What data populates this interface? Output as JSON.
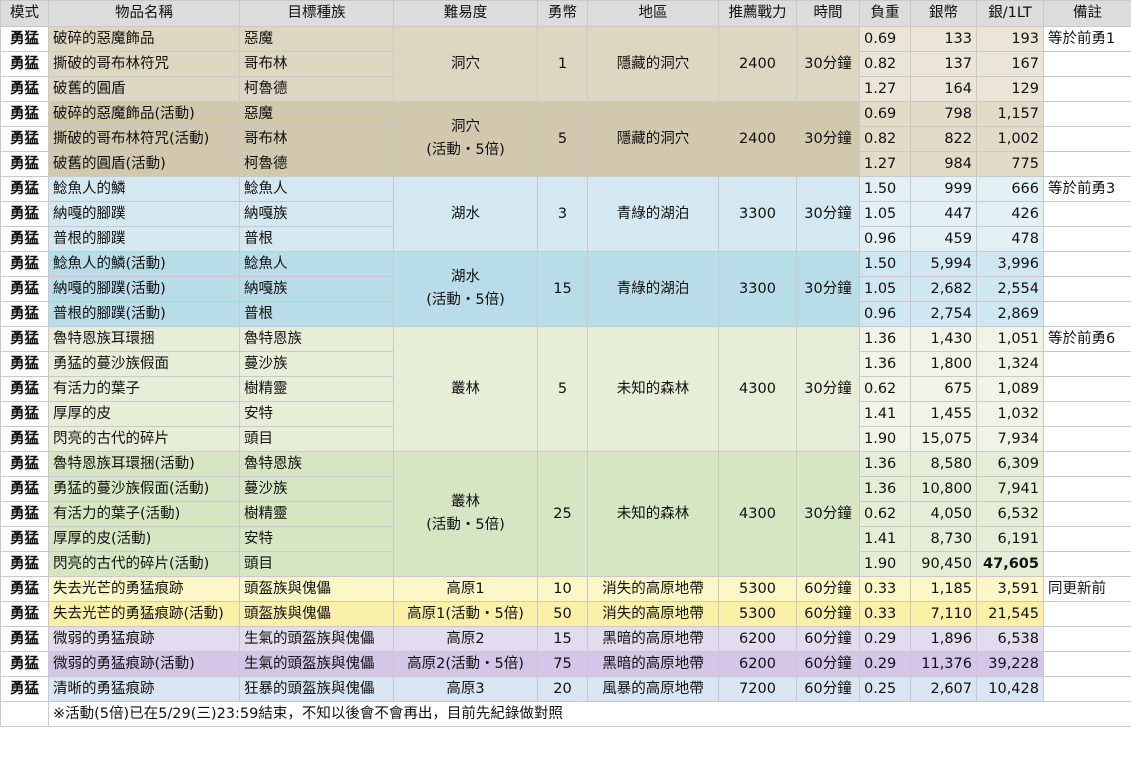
{
  "headers": [
    "模式",
    "物品名稱",
    "目標種族",
    "難易度",
    "勇幣",
    "地區",
    "推薦戰力",
    "時間",
    "負重",
    "銀幣",
    "銀/1LT",
    "備註"
  ],
  "colors": {
    "cave_a": "#ddd6c1",
    "cave_a_light": "#eae5d6",
    "cave_b": "#d1c8ad",
    "cave_b_light": "#e1dbc8",
    "lake_a": "#d3e8f1",
    "lake_a_light": "#e3f1f7",
    "lake_b": "#b8dce8",
    "lake_b_light": "#cfe7f0",
    "forest_a": "#e6eed8",
    "forest_a_light": "#eff4e6",
    "forest_b": "#d6e6c2",
    "forest_b_light": "#e4eed6",
    "plateau1": "#fdf6c6",
    "plateau1_event": "#fbf0a8",
    "plateau2": "#e3dbee",
    "plateau2_event": "#d3c6e6",
    "plateau3": "#d9e5f3"
  },
  "groups": [
    {
      "mode": "勇猛",
      "difficulty": [
        "洞穴"
      ],
      "coins": "1",
      "region": "隱藏的洞穴",
      "power": "2400",
      "time": "30分鐘",
      "bg": "cave_a",
      "bg_num": "cave_a_light",
      "rows": [
        {
          "item": "破碎的惡魔飾品",
          "race": "惡魔",
          "weight": "0.69",
          "silver": "133",
          "per": "193",
          "note": "等於前勇1"
        },
        {
          "item": "撕破的哥布林符咒",
          "race": "哥布林",
          "weight": "0.82",
          "silver": "137",
          "per": "167",
          "note": ""
        },
        {
          "item": "破舊的圓盾",
          "race": "柯魯德",
          "weight": "1.27",
          "silver": "164",
          "per": "129",
          "note": ""
        }
      ]
    },
    {
      "mode": "勇猛",
      "difficulty": [
        "洞穴",
        "(活動・5倍)"
      ],
      "coins": "5",
      "region": "隱藏的洞穴",
      "power": "2400",
      "time": "30分鐘",
      "bg": "cave_b",
      "bg_num": "cave_b_light",
      "rows": [
        {
          "item": "破碎的惡魔飾品(活動)",
          "race": "惡魔",
          "weight": "0.69",
          "silver": "798",
          "per": "1,157",
          "note": ""
        },
        {
          "item": "撕破的哥布林符咒(活動)",
          "race": "哥布林",
          "weight": "0.82",
          "silver": "822",
          "per": "1,002",
          "note": ""
        },
        {
          "item": "破舊的圓盾(活動)",
          "race": "柯魯德",
          "weight": "1.27",
          "silver": "984",
          "per": "775",
          "note": ""
        }
      ]
    },
    {
      "mode": "勇猛",
      "difficulty": [
        "湖水"
      ],
      "coins": "3",
      "region": "青綠的湖泊",
      "power": "3300",
      "time": "30分鐘",
      "bg": "lake_a",
      "bg_num": "lake_a_light",
      "rows": [
        {
          "item": "鯰魚人的鱗",
          "race": "鯰魚人",
          "weight": "1.50",
          "silver": "999",
          "per": "666",
          "note": "等於前勇3"
        },
        {
          "item": "納嘎的腳蹼",
          "race": "納嘎族",
          "weight": "1.05",
          "silver": "447",
          "per": "426",
          "note": ""
        },
        {
          "item": "普根的腳蹼",
          "race": "普根",
          "weight": "0.96",
          "silver": "459",
          "per": "478",
          "note": ""
        }
      ]
    },
    {
      "mode": "勇猛",
      "difficulty": [
        "湖水",
        "(活動・5倍)"
      ],
      "coins": "15",
      "region": "青綠的湖泊",
      "power": "3300",
      "time": "30分鐘",
      "bg": "lake_b",
      "bg_num": "lake_b_light",
      "rows": [
        {
          "item": "鯰魚人的鱗(活動)",
          "race": "鯰魚人",
          "weight": "1.50",
          "silver": "5,994",
          "per": "3,996",
          "note": ""
        },
        {
          "item": "納嘎的腳蹼(活動)",
          "race": "納嘎族",
          "weight": "1.05",
          "silver": "2,682",
          "per": "2,554",
          "note": ""
        },
        {
          "item": "普根的腳蹼(活動)",
          "race": "普根",
          "weight": "0.96",
          "silver": "2,754",
          "per": "2,869",
          "note": ""
        }
      ]
    },
    {
      "mode": "勇猛",
      "difficulty": [
        "叢林"
      ],
      "coins": "5",
      "region": "未知的森林",
      "power": "4300",
      "time": "30分鐘",
      "bg": "forest_a",
      "bg_num": "forest_a_light",
      "rows": [
        {
          "item": "魯特恩族耳環捆",
          "race": "魯特恩族",
          "weight": "1.36",
          "silver": "1,430",
          "per": "1,051",
          "note": "等於前勇6"
        },
        {
          "item": "勇猛的蔓沙族假面",
          "race": "蔓沙族",
          "weight": "1.36",
          "silver": "1,800",
          "per": "1,324",
          "note": ""
        },
        {
          "item": "有活力的葉子",
          "race": "樹精靈",
          "weight": "0.62",
          "silver": "675",
          "per": "1,089",
          "note": ""
        },
        {
          "item": "厚厚的皮",
          "race": "安特",
          "weight": "1.41",
          "silver": "1,455",
          "per": "1,032",
          "note": ""
        },
        {
          "item": "閃亮的古代的碎片",
          "race": "頭目",
          "weight": "1.90",
          "silver": "15,075",
          "per": "7,934",
          "note": ""
        }
      ]
    },
    {
      "mode": "勇猛",
      "difficulty": [
        "叢林",
        "(活動・5倍)"
      ],
      "coins": "25",
      "region": "未知的森林",
      "power": "4300",
      "time": "30分鐘",
      "bg": "forest_b",
      "bg_num": "forest_b_light",
      "rows": [
        {
          "item": "魯特恩族耳環捆(活動)",
          "race": "魯特恩族",
          "weight": "1.36",
          "silver": "8,580",
          "per": "6,309",
          "note": ""
        },
        {
          "item": "勇猛的蔓沙族假面(活動)",
          "race": "蔓沙族",
          "weight": "1.36",
          "silver": "10,800",
          "per": "7,941",
          "note": ""
        },
        {
          "item": "有活力的葉子(活動)",
          "race": "樹精靈",
          "weight": "0.62",
          "silver": "4,050",
          "per": "6,532",
          "note": ""
        },
        {
          "item": "厚厚的皮(活動)",
          "race": "安特",
          "weight": "1.41",
          "silver": "8,730",
          "per": "6,191",
          "note": ""
        },
        {
          "item": "閃亮的古代的碎片(活動)",
          "race": "頭目",
          "weight": "1.90",
          "silver": "90,450",
          "per": "47,605",
          "note": "",
          "bold_per": true
        }
      ]
    },
    {
      "mode": "勇猛",
      "difficulty": [
        "高原1"
      ],
      "coins": "10",
      "region": "消失的高原地帶",
      "power": "5300",
      "time": "60分鐘",
      "bg": "plateau1",
      "bg_num": "plateau1",
      "rows": [
        {
          "item": "失去光芒的勇猛痕跡",
          "race": "頭盔族與傀儡",
          "weight": "0.33",
          "silver": "1,185",
          "per": "3,591",
          "note": "同更新前"
        }
      ]
    },
    {
      "mode": "勇猛",
      "difficulty": [
        "高原1(活動・5倍)"
      ],
      "coins": "50",
      "region": "消失的高原地帶",
      "power": "5300",
      "time": "60分鐘",
      "bg": "plateau1_event",
      "bg_num": "plateau1_event",
      "rows": [
        {
          "item": "失去光芒的勇猛痕跡(活動)",
          "race": "頭盔族與傀儡",
          "weight": "0.33",
          "silver": "7,110",
          "per": "21,545",
          "note": ""
        }
      ]
    },
    {
      "mode": "勇猛",
      "difficulty": [
        "高原2"
      ],
      "coins": "15",
      "region": "黑暗的高原地帶",
      "power": "6200",
      "time": "60分鐘",
      "bg": "plateau2",
      "bg_num": "plateau2",
      "rows": [
        {
          "item": "微弱的勇猛痕跡",
          "race": "生氣的頭盔族與傀儡",
          "weight": "0.29",
          "silver": "1,896",
          "per": "6,538",
          "note": ""
        }
      ]
    },
    {
      "mode": "勇猛",
      "difficulty": [
        "高原2(活動・5倍)"
      ],
      "coins": "75",
      "region": "黑暗的高原地帶",
      "power": "6200",
      "time": "60分鐘",
      "bg": "plateau2_event",
      "bg_num": "plateau2_event",
      "rows": [
        {
          "item": "微弱的勇猛痕跡(活動)",
          "race": "生氣的頭盔族與傀儡",
          "weight": "0.29",
          "silver": "11,376",
          "per": "39,228",
          "note": ""
        }
      ]
    },
    {
      "mode": "勇猛",
      "difficulty": [
        "高原3"
      ],
      "coins": "20",
      "region": "風暴的高原地帶",
      "power": "7200",
      "time": "60分鐘",
      "bg": "plateau3",
      "bg_num": "plateau3",
      "rows": [
        {
          "item": "清晰的勇猛痕跡",
          "race": "狂暴的頭盔族與傀儡",
          "weight": "0.25",
          "silver": "2,607",
          "per": "10,428",
          "note": ""
        }
      ]
    }
  ],
  "footnote": "※活動(5倍)已在5/29(三)23:59結束，不知以後會不會再出，目前先紀錄做對照"
}
